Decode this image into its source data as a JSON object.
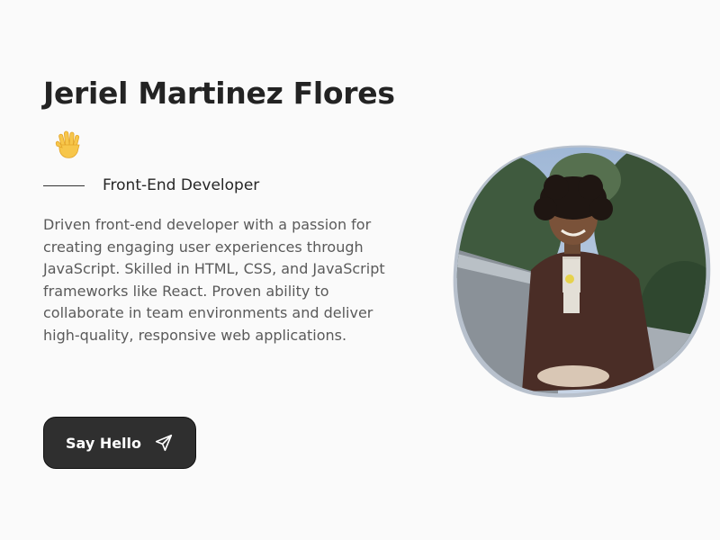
{
  "hero": {
    "name": "Jeriel Martinez Flores",
    "role": "Front-End Developer",
    "bio": "Driven front-end developer with a passion for creating engaging user experiences through JavaScript. Skilled in HTML, CSS, and JavaScript frameworks like React. Proven ability to collaborate in team environments and deliver high-quality, responsive web applications.",
    "cta_label": "Say Hello",
    "cta_icon": "send-icon",
    "wave_icon": "waving-hand-icon"
  },
  "colors": {
    "background": "#fafafa",
    "heading": "#232323",
    "body_text": "#5a5a5a",
    "button_bg": "#2f2f2f",
    "button_text": "#ffffff"
  }
}
